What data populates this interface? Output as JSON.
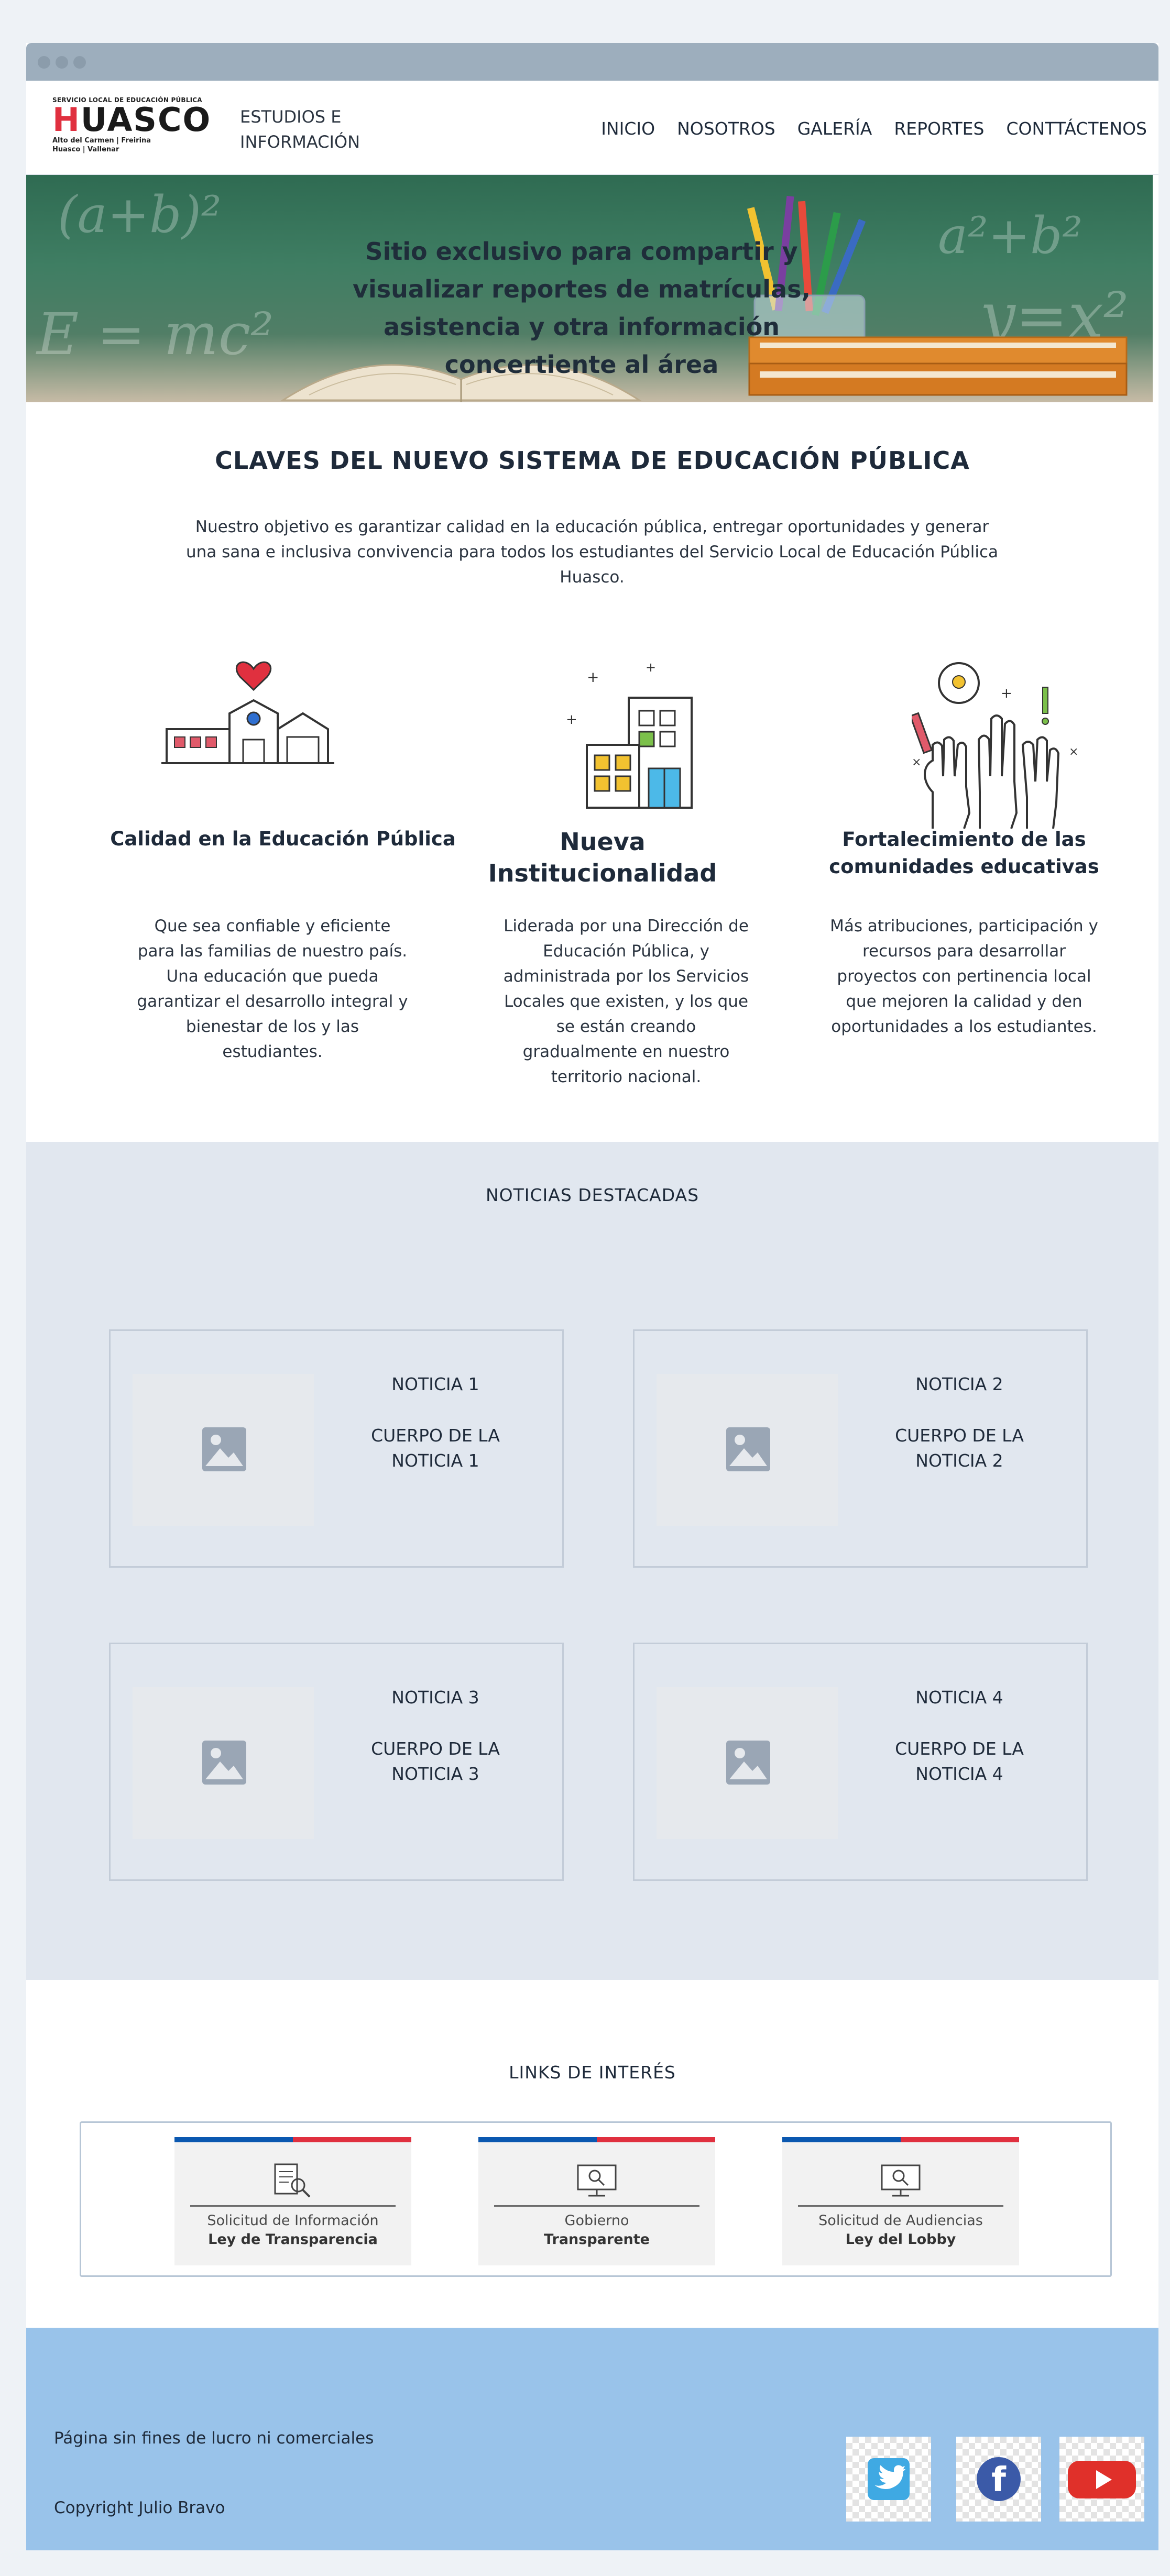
{
  "header": {
    "logo": {
      "top_line": "SERVICIO LOCAL DE EDUCACIÓN PÚBLICA",
      "name": "HUASCO",
      "sub_line_1": "Alto del Carmen | Freirina",
      "sub_line_2": "Huasco | Vallenar"
    },
    "site_title": "ESTUDIOS E INFORMACIÓN",
    "nav": [
      "INICIO",
      "NOSOTROS",
      "GALERÍA",
      "REPORTES",
      "CONTTÁCTENOS"
    ]
  },
  "hero": {
    "text": "Sitio exclusivo para compartir y visualizar reportes de matrículas, asistencia y otra información concertiente al área"
  },
  "claves": {
    "title": "CLAVES DEL NUEVO SISTEMA DE EDUCACIÓN PÚBLICA",
    "description": "Nuestro objetivo es garantizar calidad en la educación pública, entregar oportunidades y generar una sana e inclusiva convivencia para todos los estudiantes del Servicio Local de Educación Pública Huasco.",
    "features": [
      {
        "icon": "school-heart-icon",
        "title": "Calidad en la Educación Pública",
        "text": "Que sea confiable y eficiente para las familias de nuestro país. Una educación que pueda garantizar el desarrollo integral y bienestar de los y las estudiantes."
      },
      {
        "icon": "building-icon",
        "title": "Nueva Institucionalidad",
        "text": "Liderada por una Dirección de Educación Pública, y administrada por los Servicios Locales que existen, y los que se están creando gradualmente en nuestro territorio nacional."
      },
      {
        "icon": "raised-hands-icon",
        "title": "Fortalecimiento de las comunidades educativas",
        "text": "Más atribuciones, participación y recursos para desarrollar proyectos con pertinencia local que mejoren la calidad y den oportunidades a los estudiantes."
      }
    ]
  },
  "news": {
    "title": "NOTICIAS DESTACADAS",
    "items": [
      {
        "title": "NOTICIA 1",
        "body": "CUERPO DE LA NOTICIA 1"
      },
      {
        "title": "NOTICIA 2",
        "body": "CUERPO DE LA NOTICIA 2"
      },
      {
        "title": "NOTICIA 3",
        "body": "CUERPO DE LA NOTICIA 3"
      },
      {
        "title": "NOTICIA 4",
        "body": "CUERPO DE LA NOTICIA 4"
      }
    ]
  },
  "links": {
    "title": "LINKS DE INTERÉS",
    "items": [
      {
        "icon": "document-search-icon",
        "line1": "Solicitud de Información",
        "line2": "Ley de Transparencia"
      },
      {
        "icon": "monitor-search-icon",
        "line1": "Gobierno",
        "line2": "Transparente"
      },
      {
        "icon": "monitor-search-icon",
        "line1": "Solicitud de Audiencias",
        "line2": "Ley del Lobby"
      }
    ]
  },
  "footer": {
    "note": "Página sin fines de lucro ni comerciales",
    "copyright": "Copyright Julio Bravo",
    "social": [
      "twitter-icon",
      "facebook-icon",
      "youtube-icon"
    ]
  },
  "colors": {
    "accent_red": "#e0303f",
    "accent_blue": "#0b58b0",
    "news_bg": "#e1e7ef",
    "footer_bg": "#99c3ea",
    "titlebar": "#9daebd"
  }
}
